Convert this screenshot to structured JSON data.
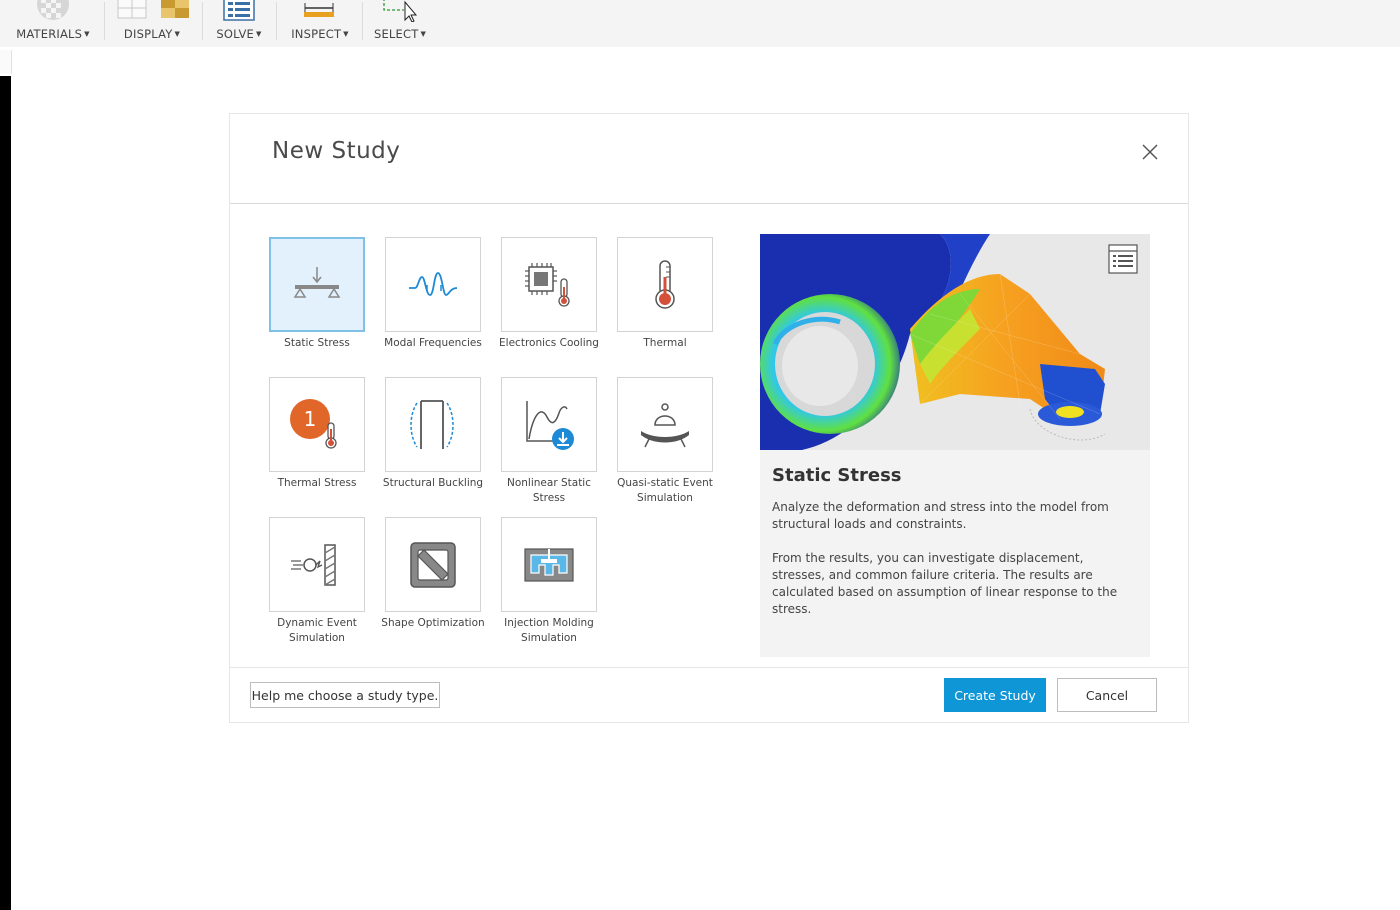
{
  "toolbar": {
    "groups": [
      {
        "label": "MATERIALS",
        "icon": "materials-sphere-icon"
      },
      {
        "label": "DISPLAY",
        "icon": "display-icon"
      },
      {
        "label": "SOLVE",
        "icon": "solve-list-icon"
      },
      {
        "label": "INSPECT",
        "icon": "inspect-ruler-icon"
      },
      {
        "label": "SELECT",
        "icon": "select-cursor-icon"
      }
    ],
    "caret": "▼"
  },
  "dialog": {
    "title": "New Study",
    "close_icon": "close-icon",
    "study_types": [
      {
        "label": "Static Stress",
        "icon": "static-stress-icon",
        "selected": true
      },
      {
        "label": "Modal Frequencies",
        "icon": "modal-frequencies-icon"
      },
      {
        "label": "Electronics Cooling",
        "icon": "electronics-cooling-icon"
      },
      {
        "label": "Thermal",
        "icon": "thermal-icon"
      },
      {
        "label": "Thermal Stress",
        "icon": "thermal-stress-icon",
        "badge": "1"
      },
      {
        "label": "Structural Buckling",
        "icon": "structural-buckling-icon"
      },
      {
        "label": "Nonlinear Static Stress",
        "icon": "nonlinear-static-stress-icon"
      },
      {
        "label": "Quasi-static Event Simulation",
        "icon": "quasi-static-event-icon"
      },
      {
        "label": "Dynamic Event Simulation",
        "icon": "dynamic-event-icon"
      },
      {
        "label": "Shape Optimization",
        "icon": "shape-optimization-icon"
      },
      {
        "label": "Injection Molding Simulation",
        "icon": "injection-molding-icon"
      }
    ],
    "preview": {
      "title": "Static Stress",
      "paragraph1": "Analyze the deformation and stress into the model from structural loads and constraints.",
      "paragraph2": "From the results, you can investigate displacement, stresses, and common failure criteria. The results are calculated based on assumption of linear response to the stress.",
      "image_icon": "stress-result-image",
      "list_icon": "details-list-icon"
    },
    "help_button": "Help me choose a study type.",
    "create_button": "Create Study",
    "cancel_button": "Cancel"
  },
  "colors": {
    "primary": "#0f96d6",
    "selected_tile_bg": "#e2f1fb",
    "selected_tile_border": "#7fc0e6",
    "badge": "#e0662a",
    "thermometer_red": "#d4503a"
  }
}
